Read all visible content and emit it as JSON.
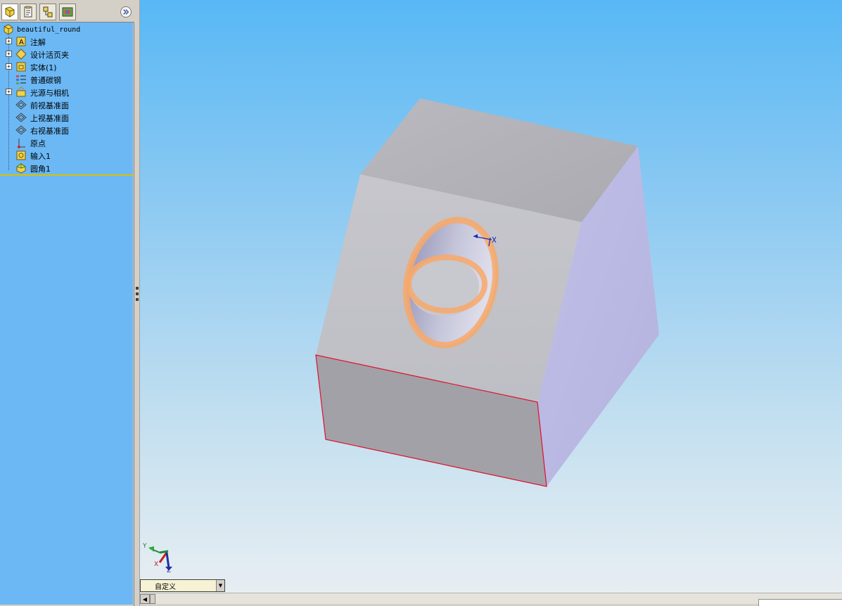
{
  "feature_tree": {
    "root": {
      "label": "beautiful_round",
      "icon": "part-icon"
    },
    "items": [
      {
        "label": "注解",
        "icon": "annotations-icon",
        "expandable": true
      },
      {
        "label": "设计活页夹",
        "icon": "design-binder-icon",
        "expandable": true
      },
      {
        "label": "实体(1)",
        "icon": "solid-bodies-icon",
        "expandable": true
      },
      {
        "label": "普通碳钢",
        "icon": "material-icon",
        "expandable": false
      },
      {
        "label": "光源与相机",
        "icon": "lights-cameras-icon",
        "expandable": true
      },
      {
        "label": "前视基准面",
        "icon": "plane-icon",
        "expandable": false
      },
      {
        "label": "上视基准面",
        "icon": "plane-icon",
        "expandable": false
      },
      {
        "label": "右视基准面",
        "icon": "plane-icon",
        "expandable": false
      },
      {
        "label": "原点",
        "icon": "origin-icon",
        "expandable": false
      },
      {
        "label": "输入1",
        "icon": "imported-feature-icon",
        "expandable": false
      },
      {
        "label": "圆角1",
        "icon": "fillet-icon",
        "expandable": false
      }
    ]
  },
  "panel_tabs": [
    {
      "name": "feature-manager-tab",
      "icon": "feature-tree-icon",
      "active": true
    },
    {
      "name": "property-manager-tab",
      "icon": "property-icon",
      "active": false
    },
    {
      "name": "configuration-manager-tab",
      "icon": "configuration-icon",
      "active": false
    },
    {
      "name": "display-manager-tab",
      "icon": "display-icon",
      "active": false
    }
  ],
  "triad": {
    "x": "X",
    "y": "Y",
    "z": "Z"
  },
  "view_selector": {
    "value": "自定义"
  },
  "colors": {
    "viewport_top": "#58b8f5",
    "viewport_bottom": "#e8eef2",
    "face_top": "#b3b3ba",
    "face_front": "#c3c3c9",
    "face_right": "#b9b8e2",
    "face_bottom": "#a2a1a8",
    "edge_highlight": "#e0102a",
    "fillet_highlight": "#f8a868"
  }
}
